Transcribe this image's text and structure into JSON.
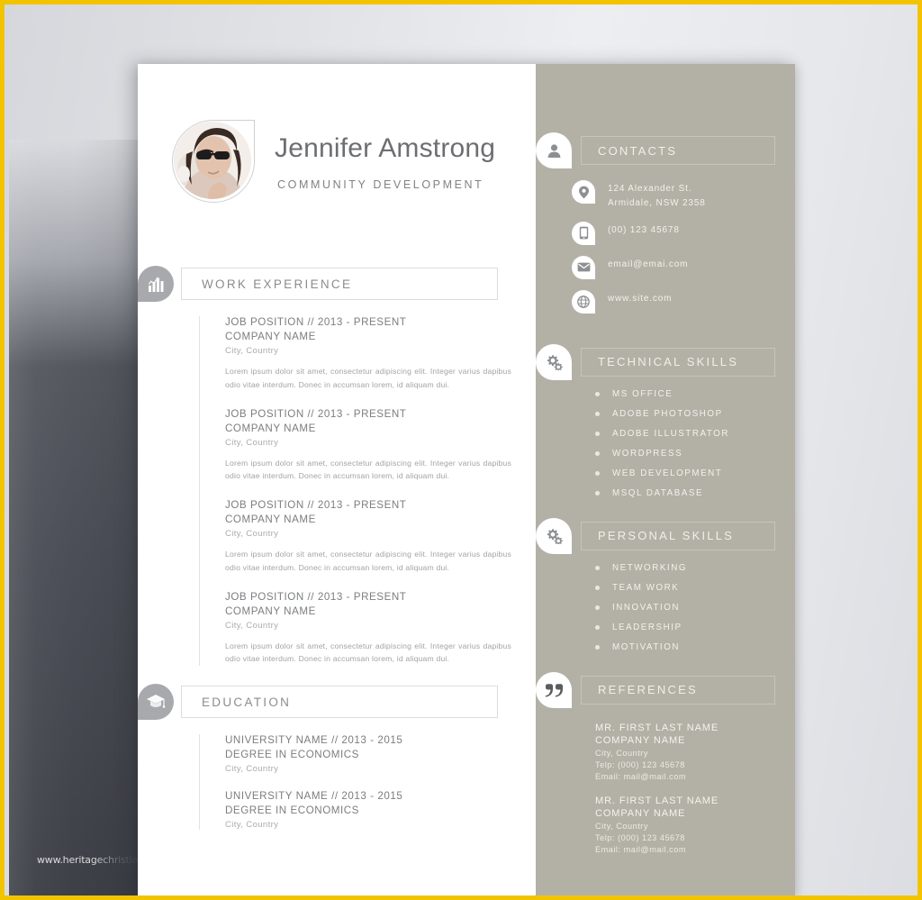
{
  "backdrop": {
    "watermark": "www.heritagechristian",
    "frame_color": "#f2c400",
    "band_color": "#4b4e56"
  },
  "header": {
    "name": "Jennifer Amstrong",
    "role": "COMMUNITY DEVELOPMENT",
    "avatar_alt": "portrait-photo"
  },
  "sections": {
    "work": {
      "title": "WORK EXPERIENCE",
      "icon": "bar-chart-icon",
      "entries": [
        {
          "position": "JOB POSITION // 2013 - PRESENT",
          "company": "COMPANY NAME",
          "location": "City, Country",
          "description": "Lorem ipsum dolor sit amet, consectetur adipiscing elit. Integer varius dapibus odio vitae interdum. Donec in accumsan lorem, id aliquam dui."
        },
        {
          "position": "JOB POSITION // 2013 - PRESENT",
          "company": "COMPANY NAME",
          "location": "City, Country",
          "description": "Lorem ipsum dolor sit amet, consectetur adipiscing elit. Integer varius dapibus odio vitae interdum. Donec in accumsan lorem, id aliquam dui."
        },
        {
          "position": "JOB POSITION // 2013 - PRESENT",
          "company": "COMPANY NAME",
          "location": "City, Country",
          "description": "Lorem ipsum dolor sit amet, consectetur adipiscing elit. Integer varius dapibus odio vitae interdum. Donec in accumsan lorem, id aliquam dui."
        },
        {
          "position": "JOB POSITION // 2013 - PRESENT",
          "company": "COMPANY NAME",
          "location": "City, Country",
          "description": "Lorem ipsum dolor sit amet, consectetur adipiscing elit. Integer varius dapibus odio vitae interdum. Donec in accumsan lorem, id aliquam dui."
        }
      ]
    },
    "education": {
      "title": "EDUCATION",
      "icon": "graduation-cap-icon",
      "entries": [
        {
          "position": "UNIVERSITY NAME // 2013 - 2015",
          "company": "DEGREE IN ECONOMICS",
          "location": "City, Country"
        },
        {
          "position": "UNIVERSITY NAME // 2013 - 2015",
          "company": "DEGREE IN ECONOMICS",
          "location": "City, Country"
        }
      ]
    },
    "contacts": {
      "title": "CONTACTS",
      "icon": "person-icon",
      "items": [
        {
          "icon": "location-pin-icon",
          "line1": "124 Alexander St.",
          "line2": "Armidale, NSW 2358"
        },
        {
          "icon": "mobile-phone-icon",
          "line1": "(00) 123 45678",
          "line2": ""
        },
        {
          "icon": "envelope-icon",
          "line1": "email@emai.com",
          "line2": ""
        },
        {
          "icon": "globe-icon",
          "line1": "www.site.com",
          "line2": ""
        }
      ]
    },
    "technical_skills": {
      "title": "TECHNICAL SKILLS",
      "icon": "gears-icon",
      "items": [
        "MS OFFICE",
        "ADOBE PHOTOSHOP",
        "ADOBE ILLUSTRATOR",
        "WORDPRESS",
        "WEB DEVELOPMENT",
        "MSQL DATABASE"
      ]
    },
    "personal_skills": {
      "title": "PERSONAL SKILLS",
      "icon": "gears-icon",
      "items": [
        "NETWORKING",
        "TEAM WORK",
        "INNOVATION",
        "LEADERSHIP",
        "MOTIVATION"
      ]
    },
    "references": {
      "title": "REFERENCES",
      "icon": "quote-icon",
      "items": [
        {
          "name": "MR. FIRST LAST NAME",
          "company": "COMPANY NAME",
          "location": "City, Country",
          "phone": "Telp: (000) 123 45678",
          "email": "Email: mail@mail.com"
        },
        {
          "name": "MR. FIRST LAST NAME",
          "company": "COMPANY NAME",
          "location": "City, Country",
          "phone": "Telp: (000) 123 45678",
          "email": "Email: mail@mail.com"
        }
      ]
    }
  }
}
